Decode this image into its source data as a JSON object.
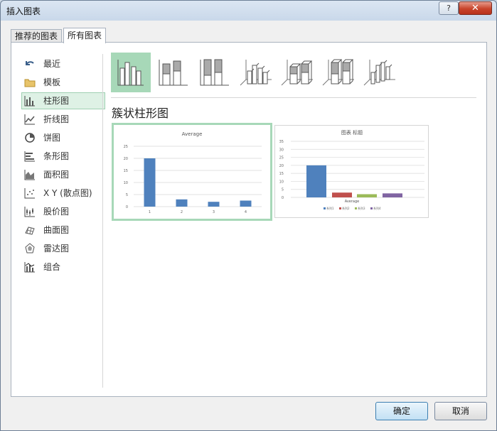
{
  "window": {
    "title": "插入图表",
    "help_label": "?",
    "close_label": "✕"
  },
  "tabs": [
    {
      "label": "推荐的图表",
      "active": false
    },
    {
      "label": "所有图表",
      "active": true
    }
  ],
  "sidebar": {
    "items": [
      {
        "label": "最近",
        "icon": "undo-arrow-icon"
      },
      {
        "label": "模板",
        "icon": "folder-icon"
      },
      {
        "label": "柱形图",
        "icon": "column-chart-icon",
        "active": true
      },
      {
        "label": "折线图",
        "icon": "line-chart-icon"
      },
      {
        "label": "饼图",
        "icon": "pie-chart-icon"
      },
      {
        "label": "条形图",
        "icon": "bar-chart-icon"
      },
      {
        "label": "面积图",
        "icon": "area-chart-icon"
      },
      {
        "label": "X Y (散点图)",
        "icon": "scatter-chart-icon"
      },
      {
        "label": "股价图",
        "icon": "stock-chart-icon"
      },
      {
        "label": "曲面图",
        "icon": "surface-chart-icon"
      },
      {
        "label": "雷达图",
        "icon": "radar-chart-icon"
      },
      {
        "label": "组合",
        "icon": "combo-chart-icon"
      }
    ]
  },
  "subtypes": [
    "clustered-column-icon",
    "stacked-column-icon",
    "100-stacked-column-icon",
    "3d-clustered-column-icon",
    "3d-stacked-column-icon",
    "3d-100-stacked-column-icon",
    "3d-column-icon"
  ],
  "selected_subtype_title": "簇状柱形图",
  "colors": {
    "accent": "#a7d8b8",
    "bar_blue": "#4f81bd",
    "bar_red": "#c0504d",
    "bar_green": "#9bbb59",
    "bar_purple": "#8064a2"
  },
  "chart_data": [
    {
      "type": "bar",
      "title": "Average",
      "categories": [
        "1",
        "2",
        "3",
        "4"
      ],
      "values": [
        20,
        3,
        2,
        2.5
      ],
      "ylim": [
        0,
        25
      ],
      "yticks": [
        "0",
        "5",
        "10",
        "15",
        "20",
        "25"
      ],
      "grid": true
    },
    {
      "type": "bar",
      "title": "图表 标题",
      "categories": [
        "Average"
      ],
      "series": [
        {
          "name": "系列1",
          "values": [
            20
          ],
          "color": "#4f81bd"
        },
        {
          "name": "系列2",
          "values": [
            3
          ],
          "color": "#c0504d"
        },
        {
          "name": "系列3",
          "values": [
            2
          ],
          "color": "#9bbb59"
        },
        {
          "name": "系列4",
          "values": [
            2.5
          ],
          "color": "#8064a2"
        }
      ],
      "ylim": [
        0,
        35
      ],
      "yticks": [
        "0",
        "5",
        "10",
        "15",
        "20",
        "25",
        "30",
        "35"
      ],
      "grid": true,
      "legend": "bottom"
    }
  ],
  "buttons": {
    "ok": "确定",
    "cancel": "取消"
  }
}
